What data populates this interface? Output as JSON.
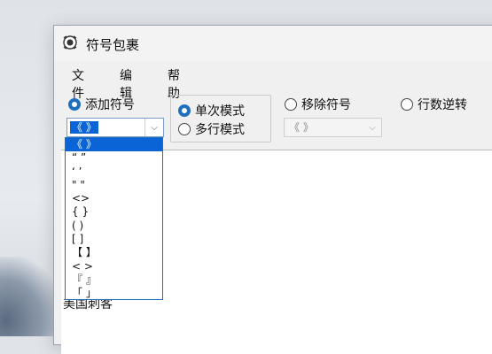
{
  "window": {
    "title": "符号包裹"
  },
  "menu": [
    "文件",
    "编辑",
    "帮助"
  ],
  "modes": {
    "add": {
      "label": "添加符号",
      "selected": true
    },
    "single": {
      "label": "单次模式",
      "selected": true
    },
    "multi": {
      "label": "多行模式",
      "selected": false
    },
    "remove": {
      "label": "移除符号",
      "selected": false
    },
    "reverse": {
      "label": "行数逆转",
      "selected": false
    }
  },
  "add_combo": {
    "value": "《 》"
  },
  "remove_combo": {
    "value": "《 》"
  },
  "dropdown": {
    "options": [
      "《 》",
      "“ ”",
      "‘ ’",
      "\" \"",
      "<>",
      "{ }",
      "( )",
      "[ ]",
      "【 】",
      "< >",
      "『 』",
      "「 」"
    ],
    "selected_index": 0
  },
  "text_area": {
    "lines": [
      "美国刺客"
    ]
  },
  "colors": {
    "accent": "#1f6fbf",
    "selection": "#0a64d6"
  }
}
